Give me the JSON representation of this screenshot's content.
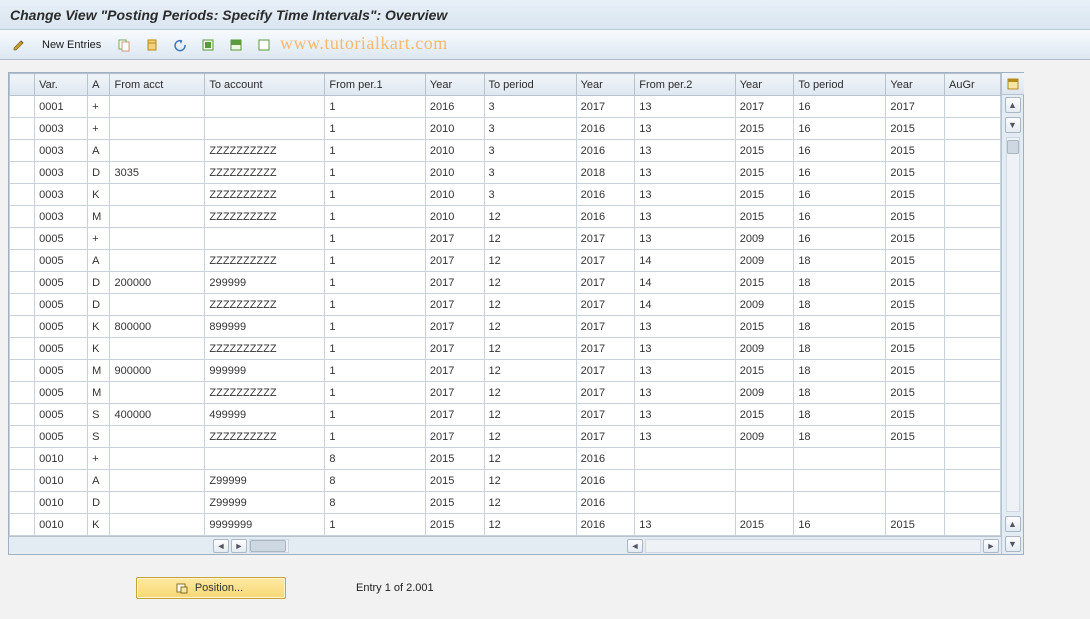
{
  "title": "Change View \"Posting Periods: Specify Time Intervals\": Overview",
  "toolbar": {
    "new_entries_label": "New Entries"
  },
  "watermark": "www.tutorialkart.com",
  "columns": {
    "var": "Var.",
    "a": "A",
    "from_acct": "From acct",
    "to_account": "To account",
    "from_per1": "From per.1",
    "year1": "Year",
    "to_period1": "To period",
    "year2": "Year",
    "from_per2": "From per.2",
    "year3": "Year",
    "to_period2": "To period",
    "year4": "Year",
    "augr": "AuGr"
  },
  "rows": [
    {
      "var": "0001",
      "a": "+",
      "from_acct": "",
      "to_account": "",
      "fp1": "1",
      "y1": "2016",
      "tp1": "3",
      "y2": "2017",
      "fp2": "13",
      "y3": "2017",
      "tp2": "16",
      "y4": "2017",
      "au": ""
    },
    {
      "var": "0003",
      "a": "+",
      "from_acct": "",
      "to_account": "",
      "fp1": "1",
      "y1": "2010",
      "tp1": "3",
      "y2": "2016",
      "fp2": "13",
      "y3": "2015",
      "tp2": "16",
      "y4": "2015",
      "au": ""
    },
    {
      "var": "0003",
      "a": "A",
      "from_acct": "",
      "to_account": "ZZZZZZZZZZ",
      "fp1": "1",
      "y1": "2010",
      "tp1": "3",
      "y2": "2016",
      "fp2": "13",
      "y3": "2015",
      "tp2": "16",
      "y4": "2015",
      "au": ""
    },
    {
      "var": "0003",
      "a": "D",
      "from_acct": "3035",
      "to_account": "ZZZZZZZZZZ",
      "fp1": "1",
      "y1": "2010",
      "tp1": "3",
      "y2": "2018",
      "fp2": "13",
      "y3": "2015",
      "tp2": "16",
      "y4": "2015",
      "au": ""
    },
    {
      "var": "0003",
      "a": "K",
      "from_acct": "",
      "to_account": "ZZZZZZZZZZ",
      "fp1": "1",
      "y1": "2010",
      "tp1": "3",
      "y2": "2016",
      "fp2": "13",
      "y3": "2015",
      "tp2": "16",
      "y4": "2015",
      "au": ""
    },
    {
      "var": "0003",
      "a": "M",
      "from_acct": "",
      "to_account": "ZZZZZZZZZZ",
      "fp1": "1",
      "y1": "2010",
      "tp1": "12",
      "y2": "2016",
      "fp2": "13",
      "y3": "2015",
      "tp2": "16",
      "y4": "2015",
      "au": ""
    },
    {
      "var": "0005",
      "a": "+",
      "from_acct": "",
      "to_account": "",
      "fp1": "1",
      "y1": "2017",
      "tp1": "12",
      "y2": "2017",
      "fp2": "13",
      "y3": "2009",
      "tp2": "16",
      "y4": "2015",
      "au": ""
    },
    {
      "var": "0005",
      "a": "A",
      "from_acct": "",
      "to_account": "ZZZZZZZZZZ",
      "fp1": "1",
      "y1": "2017",
      "tp1": "12",
      "y2": "2017",
      "fp2": "14",
      "y3": "2009",
      "tp2": "18",
      "y4": "2015",
      "au": ""
    },
    {
      "var": "0005",
      "a": "D",
      "from_acct": "200000",
      "to_account": "299999",
      "fp1": "1",
      "y1": "2017",
      "tp1": "12",
      "y2": "2017",
      "fp2": "14",
      "y3": "2015",
      "tp2": "18",
      "y4": "2015",
      "au": ""
    },
    {
      "var": "0005",
      "a": "D",
      "from_acct": "",
      "to_account": "ZZZZZZZZZZ",
      "fp1": "1",
      "y1": "2017",
      "tp1": "12",
      "y2": "2017",
      "fp2": "14",
      "y3": "2009",
      "tp2": "18",
      "y4": "2015",
      "au": ""
    },
    {
      "var": "0005",
      "a": "K",
      "from_acct": "800000",
      "to_account": "899999",
      "fp1": "1",
      "y1": "2017",
      "tp1": "12",
      "y2": "2017",
      "fp2": "13",
      "y3": "2015",
      "tp2": "18",
      "y4": "2015",
      "au": ""
    },
    {
      "var": "0005",
      "a": "K",
      "from_acct": "",
      "to_account": "ZZZZZZZZZZ",
      "fp1": "1",
      "y1": "2017",
      "tp1": "12",
      "y2": "2017",
      "fp2": "13",
      "y3": "2009",
      "tp2": "18",
      "y4": "2015",
      "au": ""
    },
    {
      "var": "0005",
      "a": "M",
      "from_acct": "900000",
      "to_account": "999999",
      "fp1": "1",
      "y1": "2017",
      "tp1": "12",
      "y2": "2017",
      "fp2": "13",
      "y3": "2015",
      "tp2": "18",
      "y4": "2015",
      "au": ""
    },
    {
      "var": "0005",
      "a": "M",
      "from_acct": "",
      "to_account": "ZZZZZZZZZZ",
      "fp1": "1",
      "y1": "2017",
      "tp1": "12",
      "y2": "2017",
      "fp2": "13",
      "y3": "2009",
      "tp2": "18",
      "y4": "2015",
      "au": ""
    },
    {
      "var": "0005",
      "a": "S",
      "from_acct": "400000",
      "to_account": "499999",
      "fp1": "1",
      "y1": "2017",
      "tp1": "12",
      "y2": "2017",
      "fp2": "13",
      "y3": "2015",
      "tp2": "18",
      "y4": "2015",
      "au": ""
    },
    {
      "var": "0005",
      "a": "S",
      "from_acct": "",
      "to_account": "ZZZZZZZZZZ",
      "fp1": "1",
      "y1": "2017",
      "tp1": "12",
      "y2": "2017",
      "fp2": "13",
      "y3": "2009",
      "tp2": "18",
      "y4": "2015",
      "au": ""
    },
    {
      "var": "0010",
      "a": "+",
      "from_acct": "",
      "to_account": "",
      "fp1": "8",
      "y1": "2015",
      "tp1": "12",
      "y2": "2016",
      "fp2": "",
      "y3": "",
      "tp2": "",
      "y4": "",
      "au": ""
    },
    {
      "var": "0010",
      "a": "A",
      "from_acct": "",
      "to_account": "Z99999",
      "fp1": "8",
      "y1": "2015",
      "tp1": "12",
      "y2": "2016",
      "fp2": "",
      "y3": "",
      "tp2": "",
      "y4": "",
      "au": ""
    },
    {
      "var": "0010",
      "a": "D",
      "from_acct": "",
      "to_account": "Z99999",
      "fp1": "8",
      "y1": "2015",
      "tp1": "12",
      "y2": "2016",
      "fp2": "",
      "y3": "",
      "tp2": "",
      "y4": "",
      "au": ""
    },
    {
      "var": "0010",
      "a": "K",
      "from_acct": "",
      "to_account": "9999999",
      "fp1": "1",
      "y1": "2015",
      "tp1": "12",
      "y2": "2016",
      "fp2": "13",
      "y3": "2015",
      "tp2": "16",
      "y4": "2015",
      "au": ""
    }
  ],
  "footer": {
    "position_label": "Position...",
    "entry_status": "Entry 1 of 2.001"
  }
}
